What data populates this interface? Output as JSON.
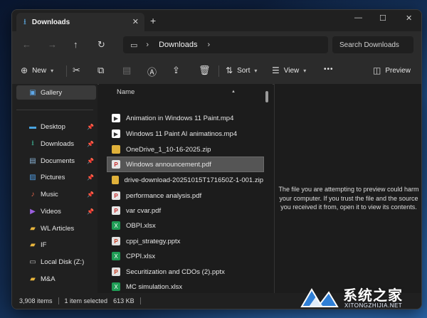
{
  "window": {
    "tab_title": "Downloads",
    "tab_close": "✕",
    "new_tab": "+",
    "minimize": "—",
    "maximize": "☐",
    "close": "✕"
  },
  "address": {
    "back": "←",
    "forward": "→",
    "up": "↑",
    "refresh": "↻",
    "crumb": "Downloads",
    "search_placeholder": "Search Downloads"
  },
  "toolbar": {
    "new_label": "New",
    "sort_label": "Sort",
    "view_label": "View",
    "more": "•••",
    "preview_label": "Preview"
  },
  "nav": {
    "items": [
      {
        "label": "Gallery",
        "icon": "gallery-icon",
        "color": "#5fa8e8",
        "pinned": false,
        "selected": true
      },
      {
        "label": "Desktop",
        "icon": "desktop-icon",
        "color": "#4aa3df",
        "pinned": true
      },
      {
        "label": "Downloads",
        "icon": "download-icon",
        "color": "#3fb89a",
        "pinned": true
      },
      {
        "label": "Documents",
        "icon": "documents-icon",
        "color": "#8ab4d8",
        "pinned": true
      },
      {
        "label": "Pictures",
        "icon": "pictures-icon",
        "color": "#4f9be0",
        "pinned": true
      },
      {
        "label": "Music",
        "icon": "music-icon",
        "color": "#e0664a",
        "pinned": true
      },
      {
        "label": "Videos",
        "icon": "videos-icon",
        "color": "#9b5fe0",
        "pinned": true
      },
      {
        "label": "WL Articles",
        "icon": "folder-icon",
        "color": "#e8b53c",
        "pinned": false
      },
      {
        "label": "IF",
        "icon": "folder-icon",
        "color": "#e8b53c",
        "pinned": false
      },
      {
        "label": "Local Disk (Z:)",
        "icon": "drive-icon",
        "color": "#bdbdbd",
        "pinned": false
      },
      {
        "label": "M&A",
        "icon": "folder-icon",
        "color": "#e8b53c",
        "pinned": false
      }
    ]
  },
  "files": {
    "column_header": "Name",
    "rows": [
      {
        "name": "Animation in Windows 11 Paint.mp4",
        "type": "mp4"
      },
      {
        "name": "Windows 11 Paint AI animatinos.mp4",
        "type": "mp4"
      },
      {
        "name": "OneDrive_1_10-16-2025.zip",
        "type": "zip"
      },
      {
        "name": "Windows announcement.pdf",
        "type": "pdf",
        "selected": true
      },
      {
        "name": "drive-download-20251015T171650Z-1-001.zip",
        "type": "zip"
      },
      {
        "name": "performance analysis.pdf",
        "type": "pdf"
      },
      {
        "name": "var cvar.pdf",
        "type": "pdf"
      },
      {
        "name": "OBPI.xlsx",
        "type": "xlsx"
      },
      {
        "name": "cppi_strategy.pptx",
        "type": "pptx"
      },
      {
        "name": "CPPI.xlsx",
        "type": "xlsx"
      },
      {
        "name": "Securitization and CDOs (2).pptx",
        "type": "pptx"
      },
      {
        "name": "MC simulation.xlsx",
        "type": "xlsx"
      }
    ]
  },
  "preview": {
    "message": "The file you are attempting to preview could harm your computer. If you trust the file and the source you received it from, open it to view its contents."
  },
  "status": {
    "item_count": "3,908 items",
    "selection": "1 item selected",
    "size": "613 KB"
  },
  "watermark": {
    "title": "系统之家",
    "subtitle": "XITONGZHIJIA.NET"
  }
}
